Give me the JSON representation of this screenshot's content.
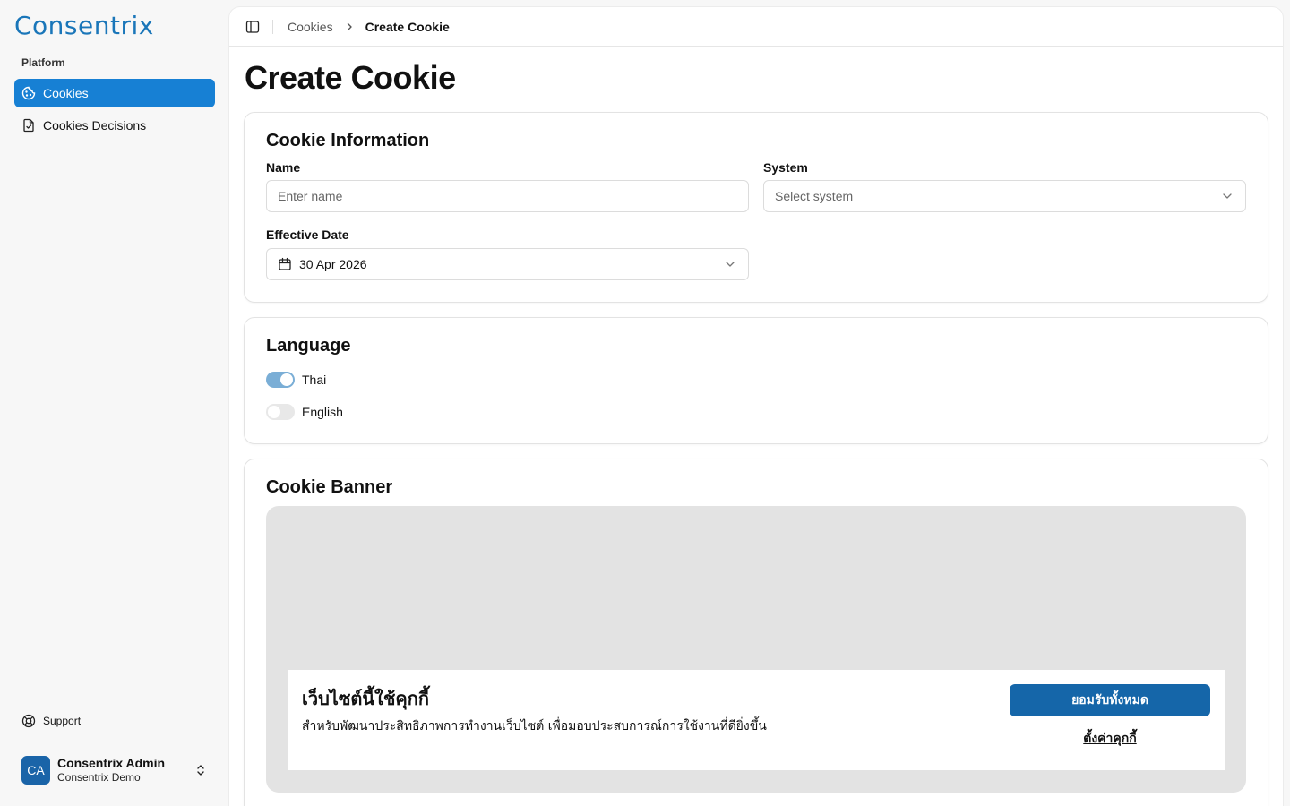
{
  "app": {
    "logo_text": "Consentrix",
    "brand_color": "#1a76b9",
    "accent_color": "#1780d4"
  },
  "sidebar": {
    "group_label": "Platform",
    "items": [
      {
        "label": "Cookies",
        "icon": "cookie-icon",
        "active": true
      },
      {
        "label": "Cookies Decisions",
        "icon": "file-check-icon",
        "active": false
      }
    ],
    "support_label": "Support",
    "user": {
      "initials": "CA",
      "name": "Consentrix Admin",
      "org": "Consentrix Demo"
    }
  },
  "breadcrumb": {
    "parent": "Cookies",
    "current": "Create Cookie"
  },
  "page_title": "Create Cookie",
  "cookie_info": {
    "title": "Cookie Information",
    "name_label": "Name",
    "name_placeholder": "Enter name",
    "system_label": "System",
    "system_placeholder": "Select system",
    "effective_date_label": "Effective Date",
    "effective_date_value": "30 Apr 2026"
  },
  "language": {
    "title": "Language",
    "options": [
      {
        "label": "Thai",
        "enabled": true
      },
      {
        "label": "English",
        "enabled": false
      }
    ]
  },
  "cookie_banner": {
    "title": "Cookie Banner",
    "banner_heading": "เว็บไซต์นี้ใช้คุกกี้",
    "banner_description": "สำหรับพัฒนาประสิทธิภาพการทำงานเว็บไซต์ เพื่อมอบประสบการณ์การใช้งานที่ดียิ่งขึ้น",
    "accept_all_label": "ยอมรับทั้งหมด",
    "settings_label": "ตั้งค่าคุกกี้"
  }
}
